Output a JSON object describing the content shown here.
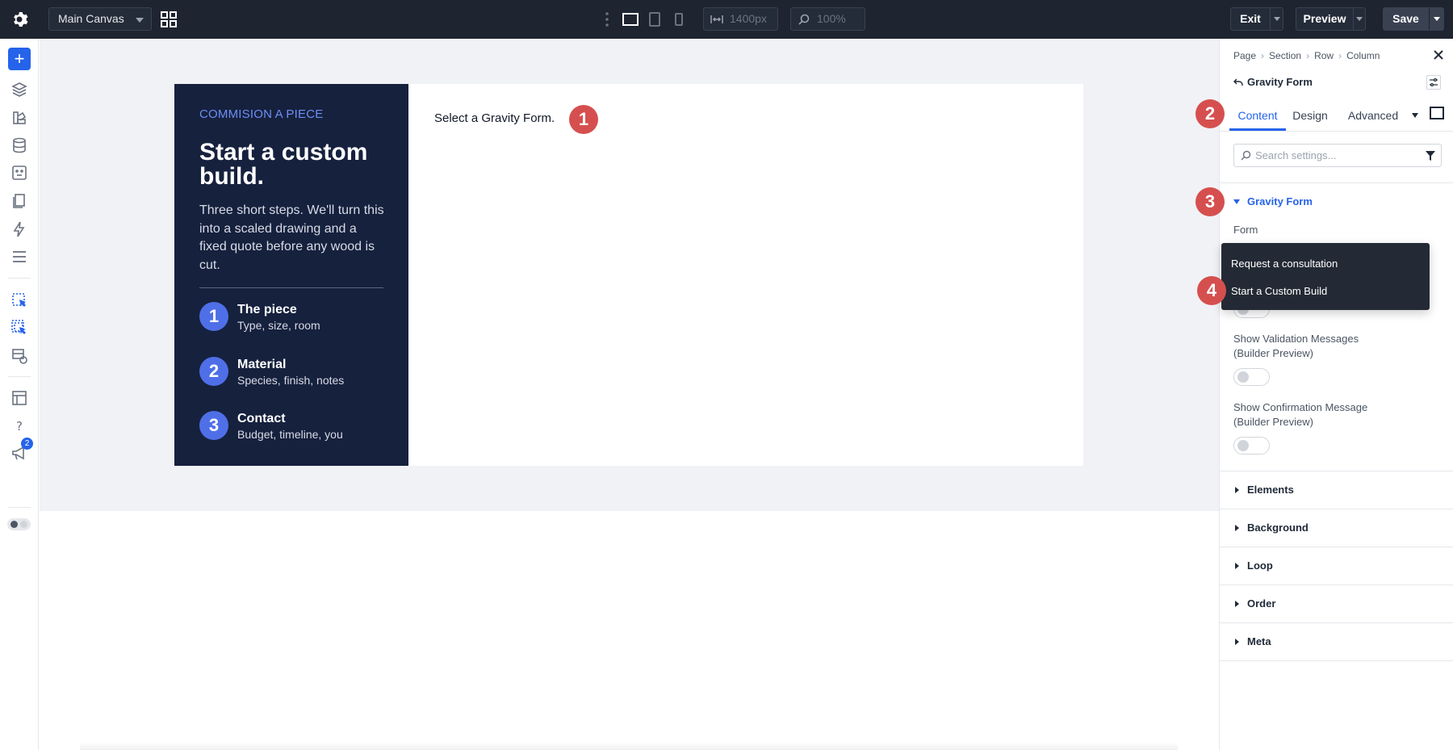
{
  "topbar": {
    "canvas_select": "Main Canvas",
    "width_value": "1400px",
    "zoom_value": "100%",
    "exit_label": "Exit",
    "preview_label": "Preview",
    "save_label": "Save"
  },
  "rail": {
    "add_label": "+",
    "notification_count": "2"
  },
  "canvas": {
    "card": {
      "eyebrow": "COMMISION A PIECE",
      "title": "Start a custom build.",
      "description": "Three short steps. We'll turn this into a scaled drawing and a fixed quote before any wood is cut.",
      "steps": [
        {
          "num": "1",
          "name": "The piece",
          "sub": "Type, size, room"
        },
        {
          "num": "2",
          "name": "Material",
          "sub": "Species, finish, notes"
        },
        {
          "num": "3",
          "name": "Contact",
          "sub": "Budget, timeline, you"
        }
      ]
    },
    "form_message": "Select a Gravity Form."
  },
  "markers": [
    "1",
    "2",
    "3",
    "4"
  ],
  "panel": {
    "breadcrumb": [
      "Page",
      "Section",
      "Row",
      "Column"
    ],
    "module_title": "Gravity Form",
    "tabs": [
      "Content",
      "Design",
      "Advanced"
    ],
    "search_placeholder": "Search settings...",
    "group_title": "Gravity Form",
    "form_label": "Form",
    "dropdown_options": [
      "Request a consultation",
      "Start a Custom Build"
    ],
    "settings": [
      {
        "label": "Show Validation Messages (Builder Preview)",
        "on": false
      },
      {
        "label": "Show Confirmation Message (Builder Preview)",
        "on": false
      }
    ],
    "sections": [
      "Elements",
      "Background",
      "Loop",
      "Order",
      "Meta"
    ]
  }
}
